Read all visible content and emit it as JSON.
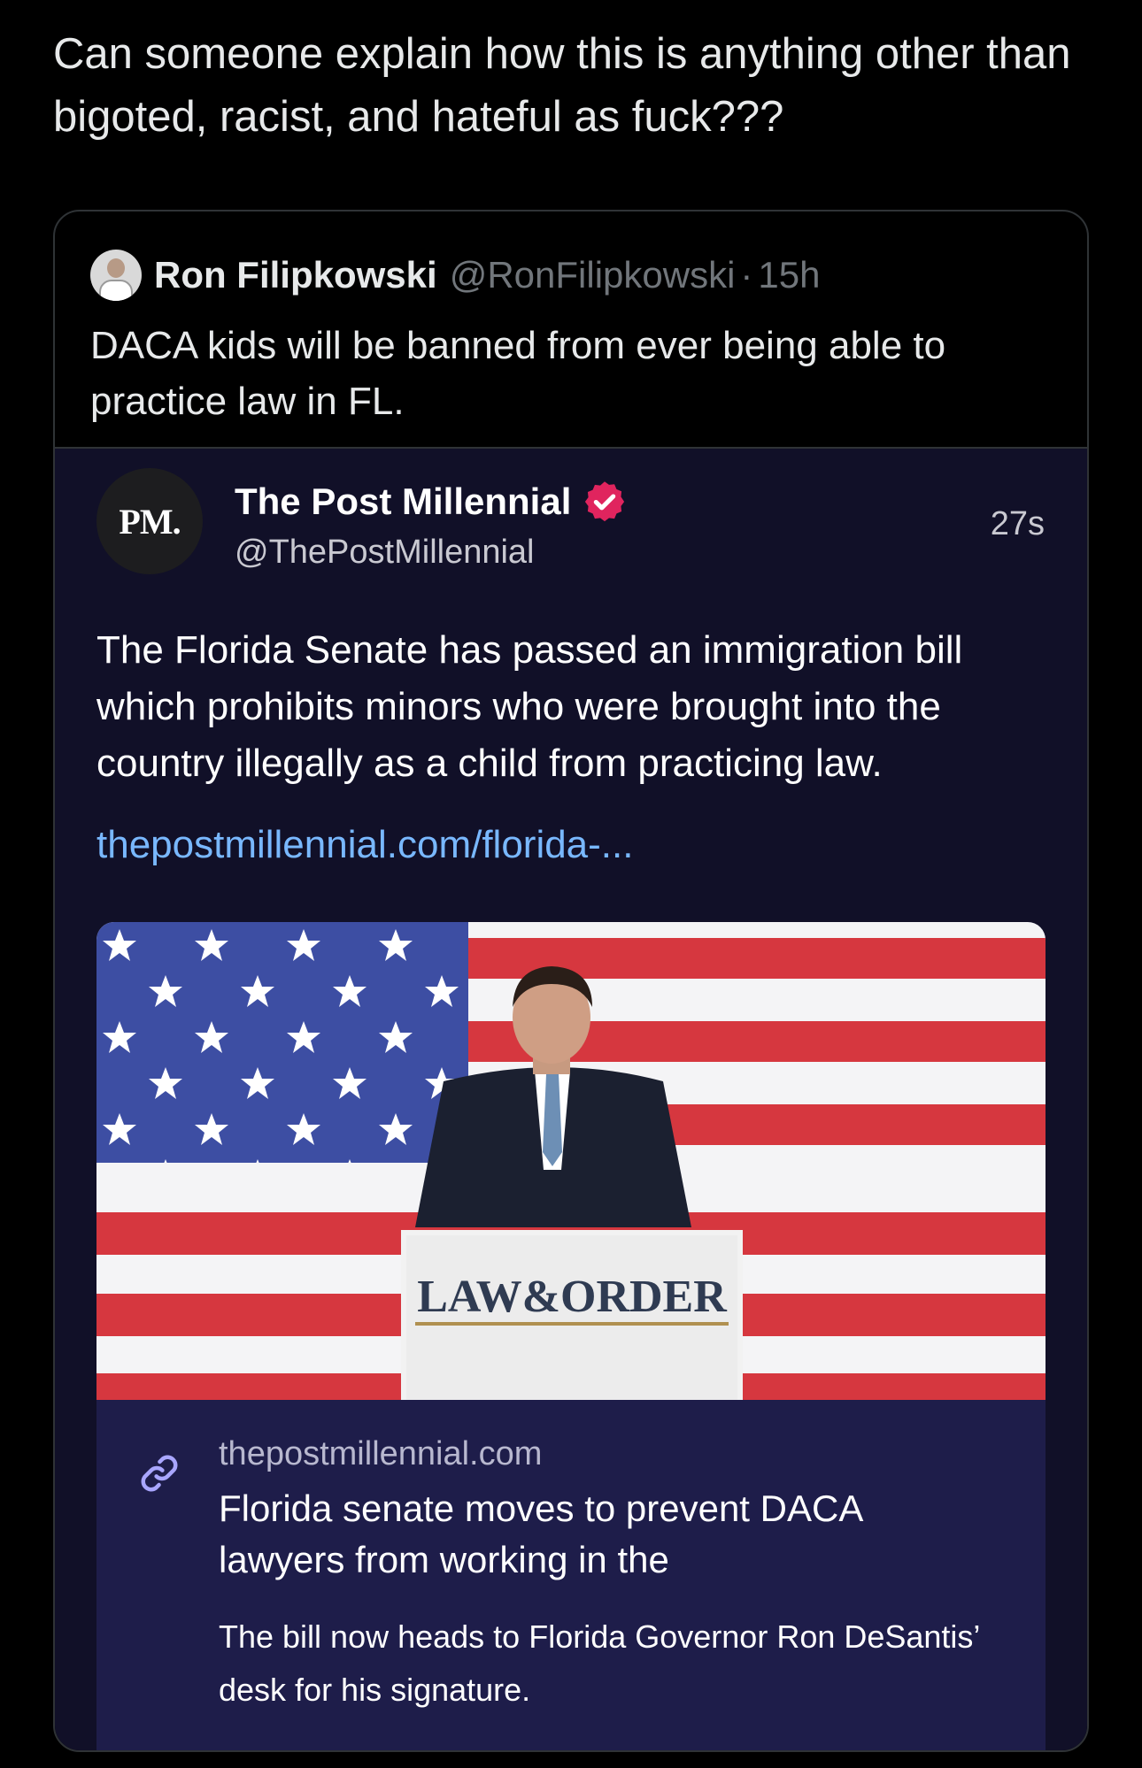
{
  "post": {
    "text": "Can someone explain how this is anything other than bigoted, racist, and hateful as fuck???"
  },
  "quote": {
    "author_name": "Ron Filipkowski",
    "author_handle": "@RonFilipkowski",
    "separator": "·",
    "time": "15h",
    "text": "DACA kids will be banned from ever being able to practice law in FL."
  },
  "embed": {
    "avatar_text": "PM.",
    "name": "The Post Millennial",
    "handle": "@ThePostMillennial",
    "time": "27s",
    "text": "The Florida Senate has passed an immigration bill which prohibits minors who were brought into the country illegally as a child from practicing law.",
    "link_text": "thepostmillennial.com/florida-...",
    "image": {
      "podium_sign": "LAW&ORDER"
    },
    "preview": {
      "domain": "thepostmillennial.com",
      "title": "Florida senate moves to prevent DACA lawyers from working in the",
      "description": "The bill now heads to Florida Governor Ron DeSantis’ desk for his signature."
    }
  },
  "icons": {
    "verified": "verified-badge-icon",
    "link": "link-icon"
  },
  "colors": {
    "background": "#000000",
    "embed_background": "#111028",
    "preview_background": "#1e1d4a",
    "link": "#79b8ff",
    "verified_badge": "#e0245e",
    "muted_text": "#71767b"
  }
}
